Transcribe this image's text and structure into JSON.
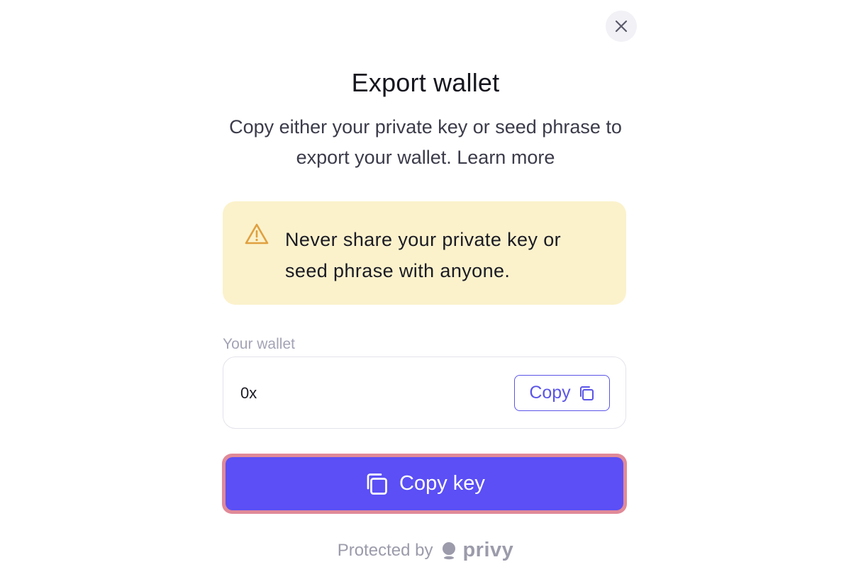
{
  "modal": {
    "title": "Export wallet",
    "subtitle_text": "Copy either your private key or seed phrase to export your wallet.",
    "learn_more": "Learn more"
  },
  "warning": {
    "icon": "warning-triangle-icon",
    "line1": "Never share your private key or",
    "line2": "seed phrase with anyone."
  },
  "wallet": {
    "label": "Your wallet",
    "address": "0x",
    "copy_label": "Copy",
    "copy_icon": "copy-icon"
  },
  "primary_action": {
    "label": "Copy key",
    "icon": "copy-icon"
  },
  "footer": {
    "protected_by": "Protected by",
    "brand": "privy"
  },
  "colors": {
    "accent": "#5b4ff5",
    "accent_outline": "#5b55e8",
    "warning_bg": "#fbf2cc",
    "warning_icon": "#e0a040",
    "focus_ring": "#e08a98"
  }
}
